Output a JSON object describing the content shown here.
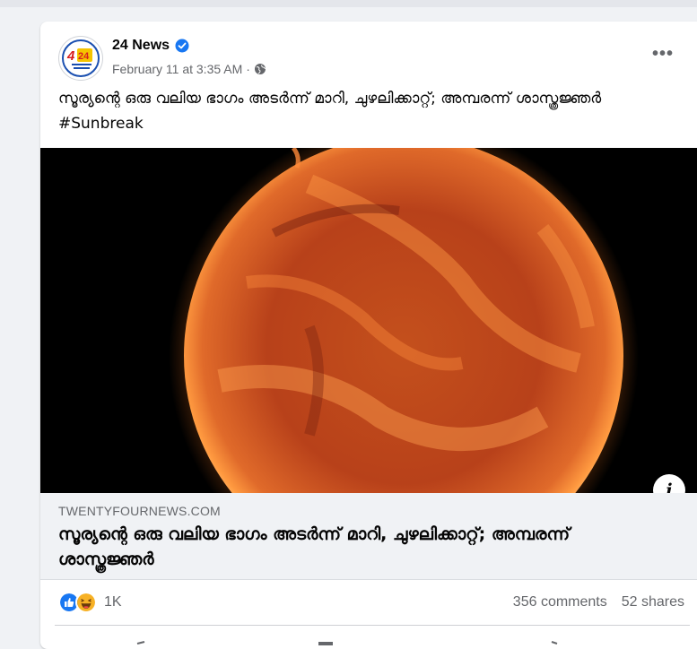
{
  "post": {
    "page_name": "24 News",
    "verified_icon": "verified-badge-icon",
    "date": "February 11 at 3:35 AM",
    "dot": "·",
    "privacy_icon": "globe-icon",
    "more_label": "•••",
    "caption": "സൂര്യന്റെ ഒരു വലിയ ഭാഗം അടർന്ന് മാറി, ചുഴലിക്കാറ്റ്; അമ്പരന്ന് ശാസ്ത്രജ്ഞർ",
    "hashtag": "#Sunbreak"
  },
  "link": {
    "image_description": "sun-image",
    "info_label": "i",
    "domain": "TWENTYFOURNEWS.COM",
    "title": "സൂര്യന്റെ ഒരു വലിയ ഭാഗം അടർന്ന് മാറി, ചുഴലിക്കാറ്റ്; അമ്പരന്ന് ശാസ്ത്രജ്ഞർ"
  },
  "stats": {
    "reactions": [
      "like-icon",
      "haha-icon"
    ],
    "reaction_count": "1K",
    "comments": "356 comments",
    "shares": "52 shares"
  },
  "colors": {
    "like_blue": "#1877f2",
    "haha_yellow": "#f7b125",
    "secondary_text": "#65676b"
  }
}
